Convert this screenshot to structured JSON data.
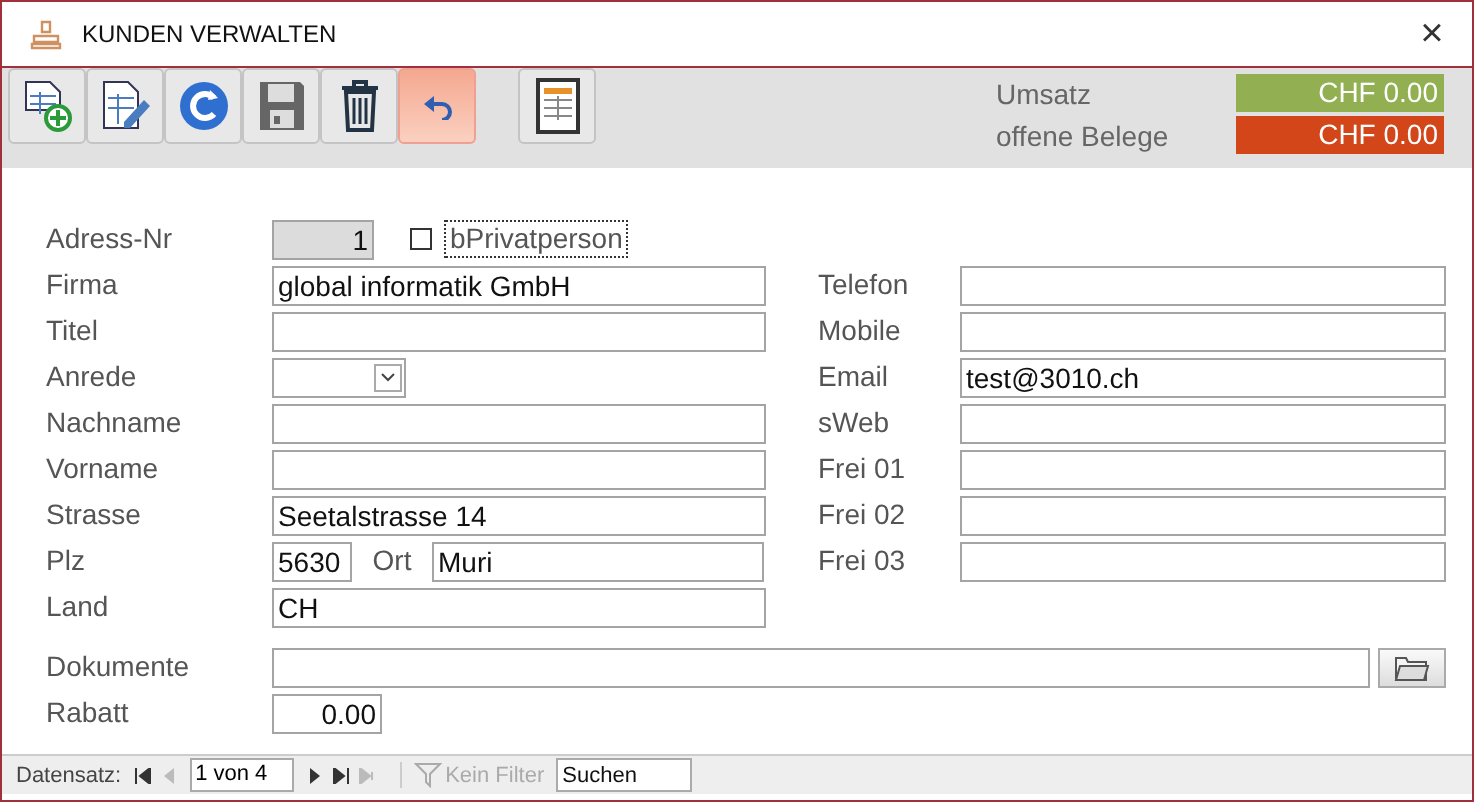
{
  "window": {
    "title": "KUNDEN VERWALTEN",
    "close": "×"
  },
  "toolbar": [
    {
      "kind": "new",
      "highlighted": false
    },
    {
      "kind": "edit",
      "highlighted": false
    },
    {
      "kind": "refresh",
      "highlighted": false
    },
    {
      "kind": "save",
      "highlighted": false
    },
    {
      "kind": "delete",
      "highlighted": false
    },
    {
      "kind": "undo",
      "highlighted": true
    },
    {
      "kind": "report",
      "highlighted": false
    }
  ],
  "summary": [
    {
      "label": "Umsatz",
      "value": "CHF 0.00",
      "color": "#92b052"
    },
    {
      "label": "offene Belege",
      "value": "CHF 0.00",
      "color": "#d2461a"
    }
  ],
  "address_nr": {
    "label": "Adress-Nr",
    "value": "1"
  },
  "private_checkbox": {
    "label": "bPrivatperson",
    "checked": false
  },
  "left_fields": [
    {
      "kind": "text",
      "label": "Firma",
      "value": "global informatik GmbH"
    },
    {
      "kind": "text",
      "label": "Titel"
    },
    {
      "kind": "select",
      "label": "Anrede"
    },
    {
      "kind": "text",
      "label": "Nachname"
    },
    {
      "kind": "text",
      "label": "Vorname"
    },
    {
      "kind": "text",
      "label": "Strasse",
      "value": "Seetalstrasse 14"
    },
    {
      "kind": "zip",
      "label": "Plz",
      "value": "5630",
      "city_label": "Ort",
      "city_value": "Muri"
    },
    {
      "kind": "text",
      "label": "Land",
      "value": "CH"
    }
  ],
  "right_fields": [
    {
      "label": "Telefon"
    },
    {
      "label": "Mobile"
    },
    {
      "label": "Email",
      "value": "test@3010.ch"
    },
    {
      "label": "sWeb"
    },
    {
      "label": "Frei 01"
    },
    {
      "label": "Frei 02"
    },
    {
      "label": "Frei 03"
    }
  ],
  "documents": {
    "label": "Dokumente"
  },
  "discount": {
    "label": "Rabatt",
    "value": "0.00"
  },
  "navigation": {
    "label": "Datensatz:",
    "position": "1 von 4",
    "buttons": [
      {
        "kind": "first",
        "disabled": false
      },
      {
        "kind": "prev",
        "disabled": true
      },
      {
        "kind": "next",
        "disabled": false
      },
      {
        "kind": "last",
        "disabled": false
      },
      {
        "kind": "new",
        "disabled": true
      }
    ],
    "filter": {
      "label": "Kein Filter",
      "disabled": true
    },
    "search": {
      "placeholder": "Suchen"
    }
  }
}
